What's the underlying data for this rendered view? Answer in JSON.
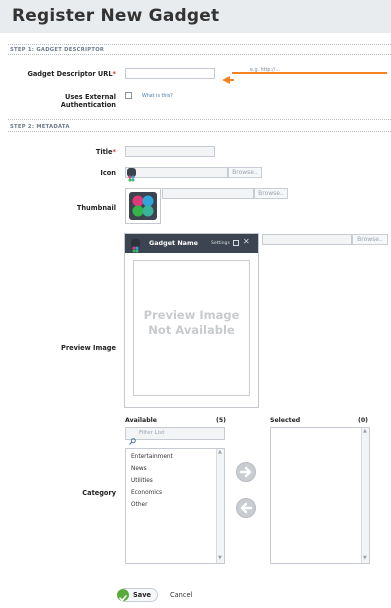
{
  "page": {
    "title": "Register New Gadget"
  },
  "step1": {
    "heading": "STEP 1: GADGET DESCRIPTOR",
    "descriptor_label": "Gadget Descriptor URL",
    "descriptor_required": "*",
    "descriptor_value": "",
    "hint": "e.g. http://...",
    "auth_label": "Uses External Authentication",
    "auth_checked": false,
    "whats_this": "What is this?"
  },
  "step2": {
    "heading": "STEP 2: METADATA",
    "title_label": "Title",
    "title_required": "*",
    "title_value": "",
    "icon_label": "Icon",
    "thumbnail_label": "Thumbnail",
    "preview_label": "Preview Image",
    "browse_label": "Browse..",
    "gadget_name": "Gadget Name",
    "settings_label": "Settings",
    "preview_text_line1": "Preview Image",
    "preview_text_line2": "Not Available",
    "category_label": "Category"
  },
  "category": {
    "available_label": "Available",
    "available_count": "(5)",
    "selected_label": "Selected",
    "selected_count": "(0)",
    "filter_placeholder": "Filter List",
    "available_items": [
      "Entertainment",
      "News",
      "Utilities",
      "Economics",
      "Other"
    ],
    "selected_items": []
  },
  "actions": {
    "save_label": "Save",
    "cancel_label": "Cancel"
  },
  "colors": {
    "accent_arrow": "#f58220",
    "header_bg": "#e9ecef",
    "section_text": "#6b7a8a",
    "link": "#4a7aa8"
  }
}
